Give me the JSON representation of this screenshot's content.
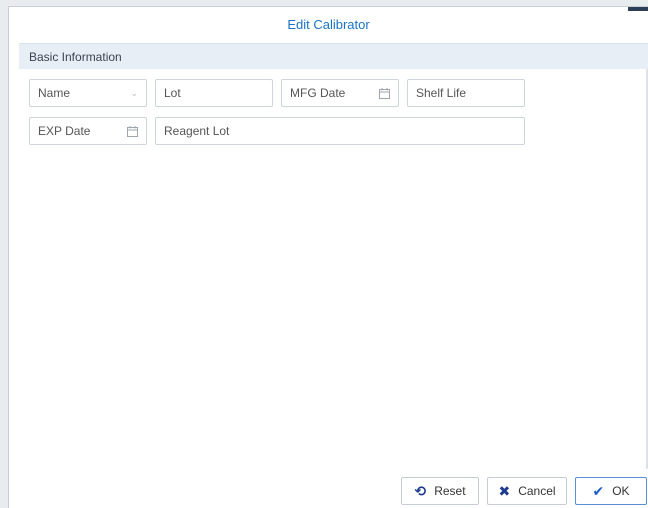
{
  "dialog": {
    "title": "Edit Calibrator"
  },
  "section": {
    "title": "Basic Information"
  },
  "fields": {
    "name": {
      "label": "Name"
    },
    "lot": {
      "label": "Lot"
    },
    "mfg_date": {
      "label": "MFG Date"
    },
    "shelf_life": {
      "label": "Shelf Life"
    },
    "exp_date": {
      "label": "EXP Date"
    },
    "reagent_lot": {
      "label": "Reagent Lot"
    }
  },
  "icons": {
    "calendar": "calendar-icon",
    "dropdown": "chevron-down-icon",
    "reset": "reset-icon",
    "cancel": "close-icon",
    "ok": "check-icon"
  },
  "buttons": {
    "reset": "Reset",
    "cancel": "Cancel",
    "ok": "OK"
  },
  "colors": {
    "title": "#1a73c8",
    "section_bg": "#e8eef5",
    "accent": "#1a5fc8"
  }
}
